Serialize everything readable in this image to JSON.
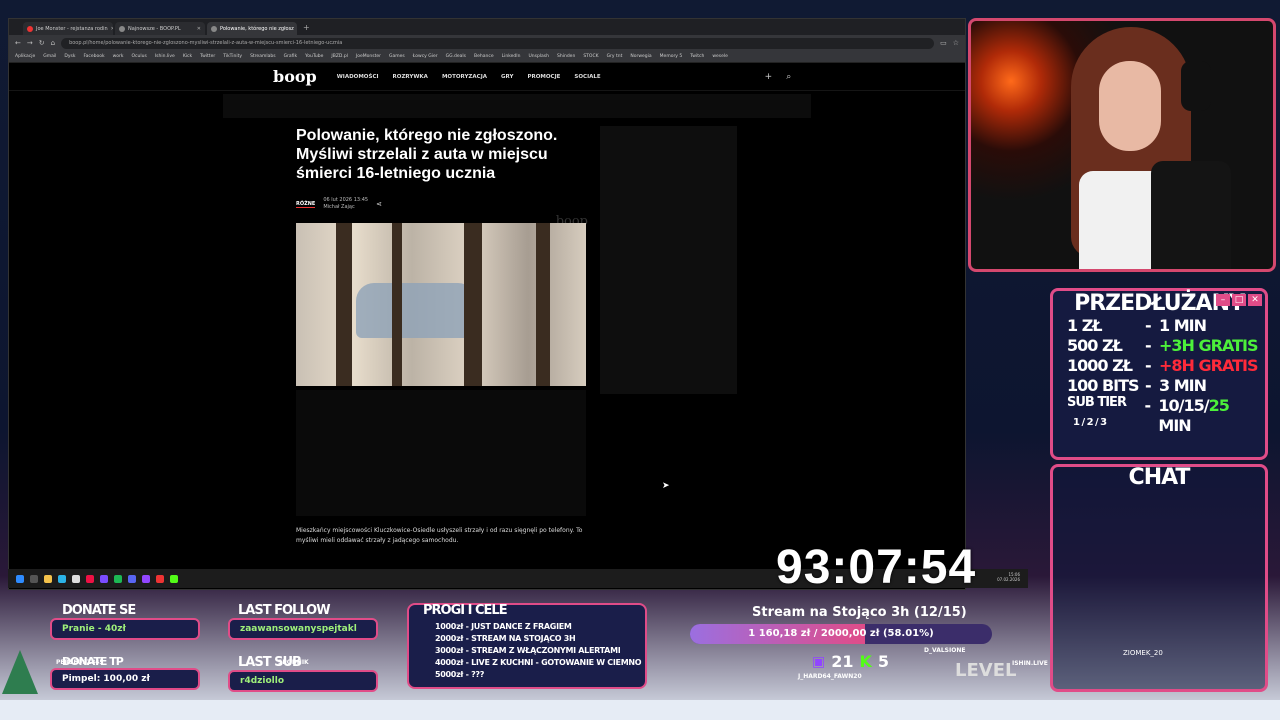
{
  "browser": {
    "tabs": [
      {
        "label": "Joe Monster - rejstanza rodin",
        "active": false
      },
      {
        "label": "Najnowsze - BOOP.PL",
        "active": false
      },
      {
        "label": "Polowanie, którego nie zgłosz",
        "active": true
      }
    ],
    "url": "boop.pl/home/polowanie-ktorego-nie-zgloszono-mysliwi-strzelali-z-auta-w-miejscu-smierci-16-letniego-ucznia",
    "bookmarks": [
      "Aplikacje",
      "Gmail",
      "Dysk",
      "Facebook",
      "work",
      "Oculus",
      "Ishin.live",
      "Kick",
      "Twitter",
      "TikTinity",
      "Streamlabs",
      "Grafik",
      "YouTube",
      "JBZD.pl",
      "JoeMonster",
      "Games",
      "Łowcy Gier",
      "GG.deals",
      "Behance",
      "LinkedIn",
      "Unsplash",
      "Shinden",
      "STOCK",
      "Gry tnt",
      "Norwegia",
      "Memory 5",
      "Twitch",
      "wesele"
    ]
  },
  "site": {
    "logo": "boop",
    "nav": [
      "WIADOMOŚCI",
      "ROZRYWKA",
      "MOTORYZACJA",
      "GRY",
      "PROMOCJE",
      "SOCIALE"
    ],
    "headline": "Polowanie, którego nie zgłoszono. Myśliwi strzelali z auta w miejscu śmierci 16-letniego ucznia",
    "category": "RÓŻNE",
    "date": "06 lut 2026 13:45",
    "author": "Michał Zając",
    "watermark": "boop",
    "lead": "Mieszkańcy miejscowości Kluczkowice-Osiedle usłyszeli strzały i od razu sięgnęli po telefony. To myśliwi mieli oddawać strzały z jadącego samochodu."
  },
  "taskbar": {
    "time": "15:06",
    "date": "07.02.2026"
  },
  "overlay": {
    "timer": "93:07:54",
    "price_panel": {
      "title": "PRZEDŁUŻANY",
      "rows": [
        {
          "left": "1 ZŁ",
          "right": "1 MIN"
        },
        {
          "left": "500 ZŁ",
          "right": "+3H GRATIS"
        },
        {
          "left": "1000 ZŁ",
          "right": "+8H GRATIS"
        },
        {
          "left": "100 BITS",
          "right": "3 MIN"
        },
        {
          "left": "SUB TIER",
          "sub": "1 / 2 / 3",
          "right": "10/15/",
          "right2": "25",
          "right3": " MIN"
        }
      ]
    },
    "chat": {
      "title": "CHAT",
      "user": "ZIOMEK_20"
    },
    "donate": {
      "label": "DONATE SE",
      "value": "Pranie - 40zł"
    },
    "donate_top": {
      "label": "DONATE TP",
      "user": "PERSEUSZ845",
      "value": "Pimpel: 100,00 zł"
    },
    "last_follow": {
      "label": "LAST FOLLOW",
      "value": "zaawansowanyspejtakl"
    },
    "last_sub": {
      "label": "LAST SUB",
      "user": "SPODNIK",
      "value": "r4dziollo"
    },
    "goals": {
      "title": "PROGI I CELE",
      "items": [
        "1000zł - JUST DANCE Z FRAGIEM",
        "2000zł - STREAM NA STOJĄCO 3H",
        "3000zł - STREAM Z WŁĄCZONYMI ALERTAMI",
        "4000zł - LIVE Z KUCHNI - GOTOWANIE W CIEMNO",
        "5000zł - ???"
      ]
    },
    "stream_goal": {
      "title": "Stream na Stojąco 3h (12/15)",
      "text": "1 160,18 zł / 2000,00 zł (58.01%)",
      "progress": 0.5801
    },
    "counters": {
      "twitch": "21",
      "kick": "5"
    },
    "names": [
      "D_VALSIONE",
      "ISHIN.LIVE",
      "J_HARD64_FAWN20",
      "LEVEL"
    ]
  }
}
